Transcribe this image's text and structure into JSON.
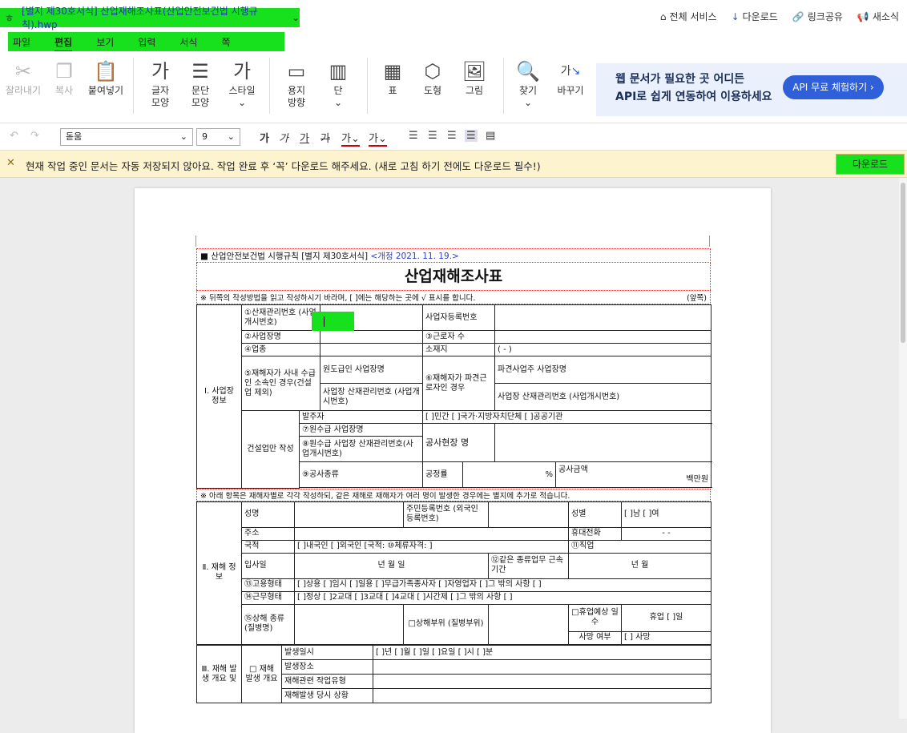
{
  "titlebar": {
    "logo": "ㅎ",
    "file_name": "[별지 제30호서식] 산업재해조사표(산업안전보건법 시행규칙).hwp",
    "links": [
      "전체 서비스",
      "다운로드",
      "링크공유",
      "새소식"
    ]
  },
  "menu": [
    "파일",
    "편집",
    "보기",
    "입력",
    "서식",
    "쪽"
  ],
  "ribbon": {
    "cut": "잘라내기",
    "copy": "복사",
    "paste": "붙여넣기",
    "char_shape_1": "글자",
    "char_shape_2": "모양",
    "para_1": "문단",
    "para_2": "모양",
    "style": "스타일",
    "paper_1": "용지",
    "paper_2": "방향",
    "col": "단",
    "table": "표",
    "shape": "도형",
    "image": "그림",
    "find": "찾기",
    "replace": "바꾸기",
    "glyph_char": "가",
    "glyph_char2": "가",
    "replace_glyph": "가"
  },
  "ad": {
    "line1": "웹 문서가 필요한 곳 어디든",
    "line2": "API로 쉽게 연동하여 이용하세요",
    "button": "API 무료 체험하기 ›"
  },
  "format": {
    "font": "돋움",
    "size": "9"
  },
  "notice": {
    "message": "현재 작업 중인 문서는 자동 저장되지 않아요. 작업 완료 후 ‘꼭’ 다운로드 해주세요. (새로 고침 하기 전에도 다운로드 필수!)",
    "button": "다운로드"
  },
  "doc": {
    "header_left": "■ 산업안전보건법 시행규칙 [별지 제30호서식]",
    "header_rev": "<개정 2021. 11. 19.>",
    "title": "산업재해조사표",
    "note": "※ 뒤쪽의 작성방법을 읽고 작성하시기 바라며, [  ]에는 해당하는 곳에 √ 표시를 합니다.",
    "note_right": "(앞쪽)",
    "s1": "Ⅰ. 사업장 정보",
    "r1a": "①산재관리번호 (사업개시번호)",
    "r1b": "사업자등록번호",
    "r2a": "②사업장명",
    "r2b": "③근로자 수",
    "r3a": "④업종",
    "r3b": "소재지",
    "r3c": "(     -     )",
    "r4a": "⑤재해자가 사내 수급인 소속인 경우(건설업 제외)",
    "r4b": "원도급인 사업장명",
    "r4c": "⑥재해자가 파견근로자인 경우",
    "r4d": "파견사업주 사업장명",
    "r5b": "사업장 산재관리번호 (사업개시번호)",
    "r5d": "사업장 산재관리번호 (사업개시번호)",
    "r6a": "건설업만 작성",
    "r6b": "발주자",
    "r6c": "[  ]민간  [  ]국가·지방자치단체  [  ]공공기관",
    "r7b": "⑦원수급 사업장명",
    "r8b": "⑧원수급 사업장 산재관리번호(사업개시번호)",
    "r8c": "공사현장 명",
    "r9b": "⑨공사종류",
    "r9c": "공정률",
    "r9d": "%",
    "r9e": "공사금액",
    "r9f": "백만원",
    "note2": "※ 아래 항목은 재해자별로 각각 작성하되, 같은 재해로 재해자가 여러 명이 발생한 경우에는 별지에 추가로 적습니다.",
    "s2": "Ⅱ. 재해 정보",
    "p1": "성명",
    "p2": "주민등록번호 (외국인등록번호)",
    "p3": "성별",
    "p4": "[  ]남    [  ]여",
    "p5": "주소",
    "p6": "휴대전화",
    "p7": "-     -",
    "p8": "국적",
    "p9": "[  ]내국인  [  ]외국인 [국적:        ⑩체류자격:        ]",
    "p10": "⑪직업",
    "p11": "입사일",
    "p12": "년    월    일",
    "p13": "⑫같은 종류업무 근속기간",
    "p14": "년    월",
    "p15": "⑬고용형태",
    "p16": "[  ]상용  [  ]임시  [  ]일용  [  ]무급가족종사자  [  ]자영업자  [  ]그 밖의 사항 [        ]",
    "p17": "⑭근무형태",
    "p18": "[  ]정상  [  ]2교대  [  ]3교대  [  ]4교대  [  ]시간제  [  ]그 밖의 사항 [        ]",
    "p19": "⑮상해 종류 (질병명)",
    "p20": "□상해부위 (질병부위)",
    "p21": "□휴업예상 일수",
    "p22": "휴업 [    ]일",
    "p23": "사망 여부",
    "p24": "[  ] 사망",
    "s3": "Ⅲ. 재해 발생 개요 및",
    "q0": "□ 재해 발생 개요",
    "q1": "발생일시",
    "q1v": "[        ]년 [    ]월 [    ]일 [    ]요일 [    ]시 [    ]분",
    "q2": "발생장소",
    "q3": "재해관련 작업유형",
    "q4": "재해발생 당시 상황"
  }
}
